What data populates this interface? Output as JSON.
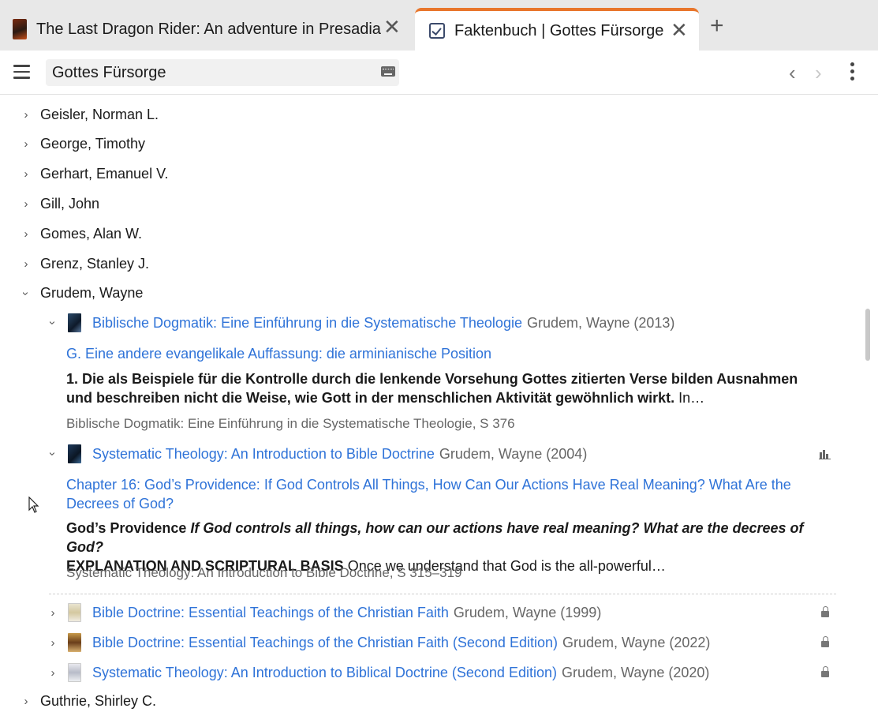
{
  "tabs": [
    {
      "title": "The Last Dragon Rider: An adventure in Presadia"
    },
    {
      "title": "Faktenbuch | Gottes Fürsorge"
    }
  ],
  "search": {
    "value": "Gottes Fürsorge"
  },
  "authors_top": [
    "Geisler, Norman L.",
    "George, Timothy",
    "Gerhart, Emanuel V.",
    "Gill, John",
    "Gomes, Alan W.",
    "Grenz, Stanley J.",
    "Grudem, Wayne"
  ],
  "book1": {
    "title": "Biblische Dogmatik: Eine Einführung in die Systematische Theologie",
    "meta": "Grudem, Wayne (2013)",
    "section": "G. Eine andere evangelikale Auffassung: die arminianische Position",
    "excerpt_bold": "1. Die als Beispiele für die Kontrolle durch die lenkende Vorsehung Gottes zitierten Verse bilden Ausnahmen und beschreiben nicht die Weise, wie Gott in der menschlichen Aktivität gewöhnlich wirkt.",
    "excerpt_rest": " In…",
    "source": "Biblische Dogmatik: Eine Einführung in die Systematische Theologie, S 376"
  },
  "book2": {
    "title": "Systematic Theology: An Introduction to Bible Doctrine",
    "meta": "Grudem, Wayne (2004)",
    "section": "Chapter 16: God’s Providence: If God Controls All Things, How Can Our Actions Have Real Meaning? What Are the Decrees of God?",
    "excerpt_bold1": "God’s Providence",
    "excerpt_italic": " If God controls all things, how can our actions have real meaning? What are the decrees of God?",
    "excerpt_bold2": "EXPLANATION AND SCRIPTURAL BASIS",
    "excerpt_rest": " Once we understand that God is the all-powerful…",
    "source": "Systematic Theology: An Introduction to Bible Doctrine, S 315–319"
  },
  "locked_books": [
    {
      "title": "Bible Doctrine: Essential Teachings of the Christian Faith",
      "meta": "Grudem, Wayne (1999)"
    },
    {
      "title": "Bible Doctrine: Essential Teachings of the Christian Faith (Second Edition)",
      "meta": "Grudem, Wayne (2022)"
    },
    {
      "title": "Systematic Theology: An Introduction to Biblical Doctrine (Second Edition)",
      "meta": "Grudem, Wayne (2020)"
    }
  ],
  "authors_bottom": [
    "Guthrie, Shirley C."
  ],
  "colors": {
    "accent": "#e8762c",
    "link": "#2f73d8",
    "meta": "#666666"
  }
}
